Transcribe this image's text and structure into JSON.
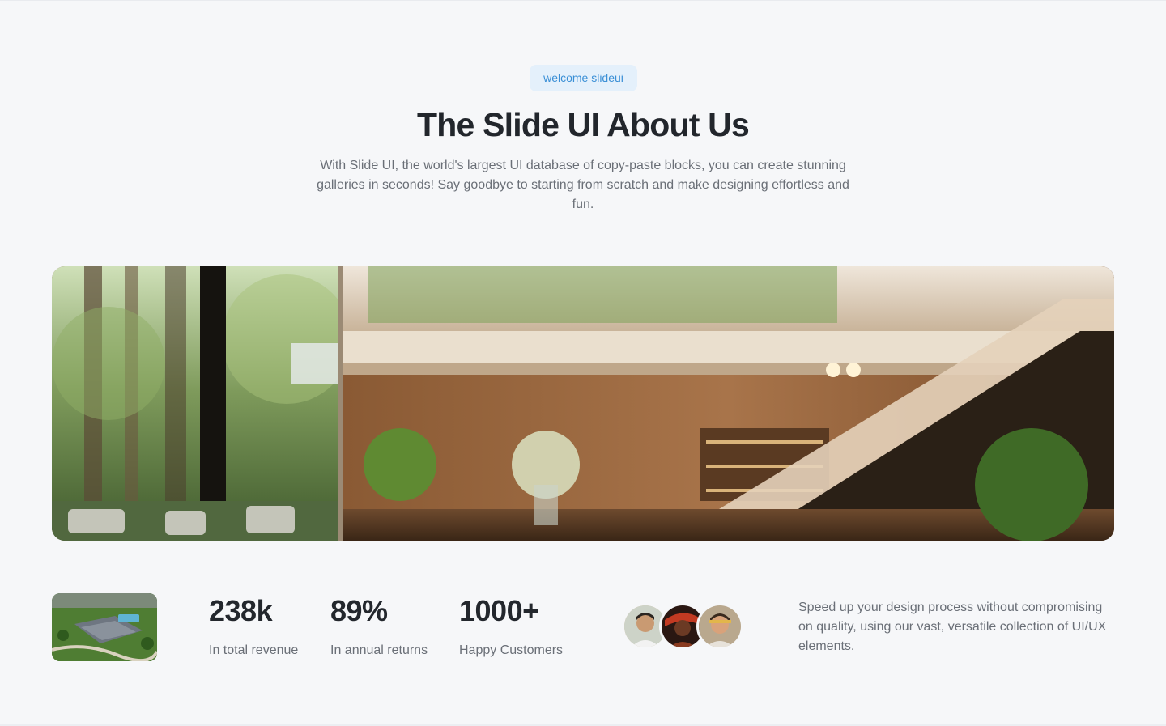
{
  "header": {
    "badge": "welcome slideui",
    "title": "The Slide UI About Us",
    "subtitle": "With Slide UI, the world's largest UI database of copy-paste blocks, you can create stunning galleries in seconds! Say goodbye to starting from scratch and make designing effortless and fun."
  },
  "stats": [
    {
      "value": "238k",
      "label": "In total revenue"
    },
    {
      "value": "89%",
      "label": "In annual returns"
    },
    {
      "value": "1000+",
      "label": "Happy Customers"
    }
  ],
  "blurb": "Speed up your design process without compromising on quality, using our vast, versatile collection of UI/UX elements.",
  "colors": {
    "background": "#f6f7f9",
    "badge_bg": "#e4f0fb",
    "badge_text": "#3a8fd6",
    "heading": "#22262c",
    "body_text": "#6a6f77"
  },
  "images": {
    "hero": "modern-interior-photo",
    "thumbnail": "aerial-house-photo",
    "avatars": [
      "customer-avatar-1",
      "customer-avatar-2",
      "customer-avatar-3"
    ]
  }
}
